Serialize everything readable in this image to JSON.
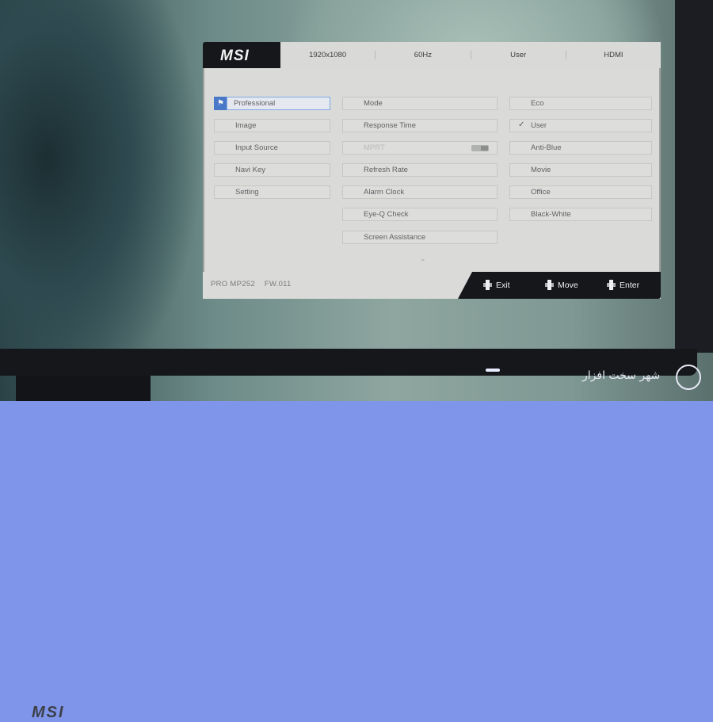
{
  "bezel": {
    "logo": "MSI"
  },
  "watermark": {
    "text": "شهر سخت افزار"
  },
  "osd": {
    "logo": "MSI",
    "info": [
      "1920x1080",
      "60Hz",
      "User",
      "HDMI"
    ],
    "menu": [
      {
        "label": "Professional",
        "icon": "flag-icon",
        "glyph": "⚑",
        "selected": true
      },
      {
        "label": "Image",
        "icon": "image-icon",
        "glyph": "≈",
        "selected": false
      },
      {
        "label": "Input Source",
        "icon": "input-arrow-icon",
        "glyph": "→",
        "selected": false
      },
      {
        "label": "Navi Key",
        "icon": "navi-key-icon",
        "glyph": "✣",
        "selected": false
      },
      {
        "label": "Setting",
        "icon": "settings-sliders-icon",
        "glyph": "☰",
        "selected": false
      }
    ],
    "submenu": [
      {
        "label": "Mode",
        "disabled": false
      },
      {
        "label": "Response Time",
        "disabled": false
      },
      {
        "label": "MPRT",
        "disabled": true
      },
      {
        "label": "Refresh Rate",
        "disabled": false
      },
      {
        "label": "Alarm Clock",
        "disabled": false
      },
      {
        "label": "Eye-Q Check",
        "disabled": false
      },
      {
        "label": "Screen Assistance",
        "disabled": false
      }
    ],
    "modes": [
      {
        "label": "Eco",
        "checked": false
      },
      {
        "label": "User",
        "checked": true
      },
      {
        "label": "Anti-Blue",
        "checked": false
      },
      {
        "label": "Movie",
        "checked": false
      },
      {
        "label": "Office",
        "checked": false
      },
      {
        "label": "Black-White",
        "checked": false
      }
    ],
    "footer": {
      "model": "PRO  MP252",
      "firmware": "FW.011",
      "keys": [
        "Exit",
        "Move",
        "Enter"
      ]
    }
  }
}
